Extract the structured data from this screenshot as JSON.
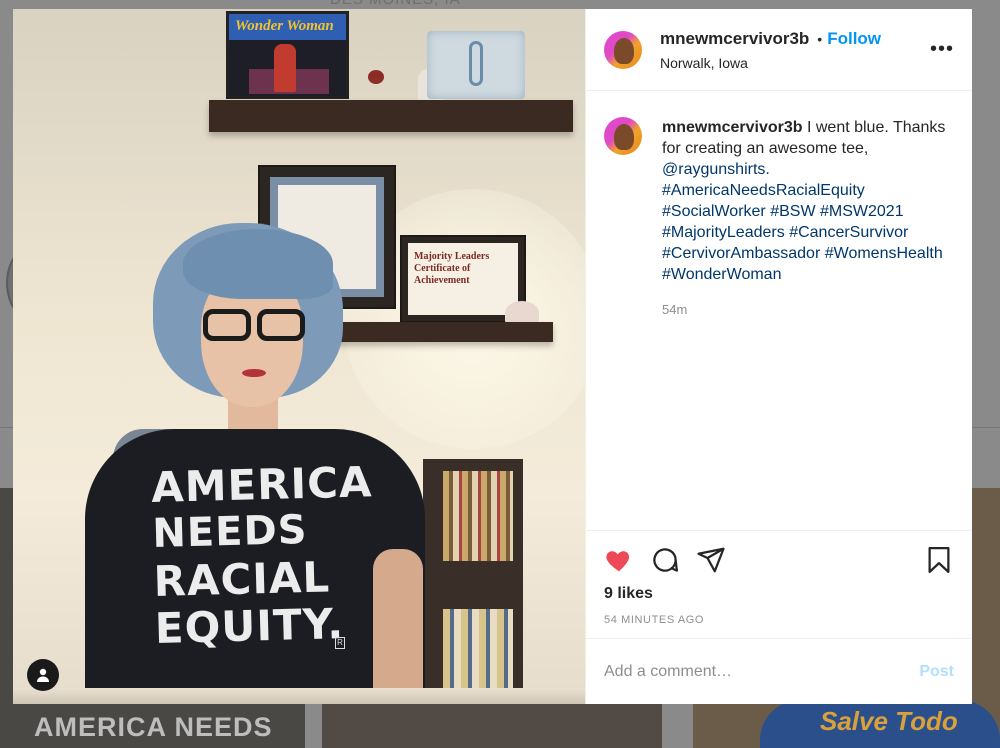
{
  "background": {
    "top_text": "DES MOINES, IA",
    "tile_left_text": "AMERICA NEEDS",
    "tile_right_text": "Salve Todo"
  },
  "photo": {
    "shirt_lines": [
      "AMERICA",
      "NEEDS",
      "RACIAL",
      "EQUITY."
    ],
    "frame_title": "Wonder Woman",
    "cert_text": "Majority Leaders Certificate of Achievement"
  },
  "post": {
    "username": "mnewmcervivor3b",
    "separator": "•",
    "follow_label": "Follow",
    "location": "Norwalk, Iowa",
    "more_label": "•••",
    "caption": {
      "username": "mnewmcervivor3b",
      "text_before": "I went blue. Thanks for creating an awesome tee,",
      "mention": "@raygunshirts.",
      "hashtags": [
        "#AmericaNeedsRacialEquity",
        "#SocialWorker",
        "#BSW",
        "#MSW2021",
        "#MajorityLeaders",
        "#CancerSurvivor",
        "#CervivorAmbassador",
        "#WomensHealth",
        "#WonderWoman"
      ],
      "time_ago": "54m"
    },
    "likes": "9 likes",
    "timestamp": "54 MINUTES AGO",
    "comment_placeholder": "Add a comment…",
    "post_label": "Post",
    "icons": [
      "heart-icon",
      "comment-icon",
      "share-icon",
      "bookmark-icon",
      "user-tag-icon"
    ],
    "colors": {
      "like_red": "#ed4956",
      "follow_blue": "#0095f6",
      "hashtag_blue": "#00376b",
      "post_disabled": "#b2dffc"
    }
  }
}
